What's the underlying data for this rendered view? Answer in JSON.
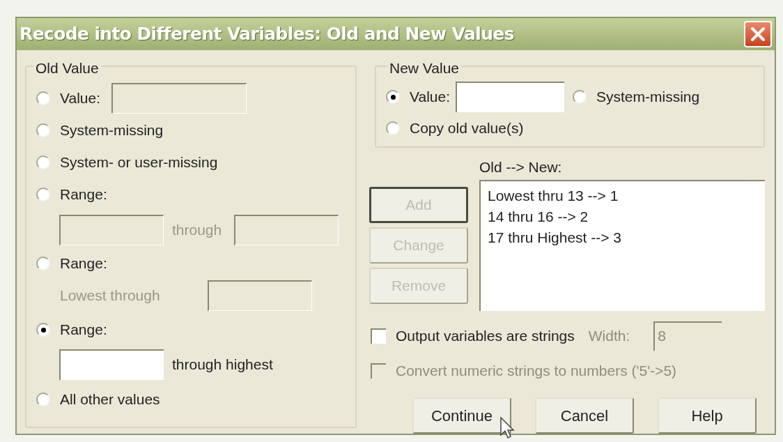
{
  "window": {
    "title": "Recode into Different Variables: Old and New Values"
  },
  "old_value": {
    "label": "Old Value",
    "options": [
      {
        "kind": "value",
        "label": "Value:",
        "selected": false
      },
      {
        "kind": "plain",
        "label": "System-missing",
        "selected": false
      },
      {
        "kind": "plain",
        "label": "System- or user-missing",
        "selected": false
      },
      {
        "kind": "range",
        "label": "Range:",
        "selected": false,
        "middle": "through"
      },
      {
        "kind": "lowest",
        "label": "Range:",
        "selected": false,
        "prefix": "Lowest through"
      },
      {
        "kind": "highest",
        "label": "Range:",
        "selected": true,
        "suffix": "through highest"
      },
      {
        "kind": "plain",
        "label": "All other values",
        "selected": false
      }
    ]
  },
  "new_value": {
    "label": "New Value",
    "options": [
      {
        "kind": "value",
        "label": "Value:",
        "selected": true
      },
      {
        "kind": "plain",
        "label": "System-missing",
        "selected": false
      },
      {
        "kind": "plain",
        "label": "Copy old value(s)",
        "selected": false
      }
    ]
  },
  "mappings": {
    "label": "Old --> New:",
    "items": [
      "Lowest thru 13 --> 1",
      "14 thru 16 --> 2",
      "17 thru Highest --> 3"
    ]
  },
  "list_buttons": [
    {
      "label": "Add",
      "disabled": true,
      "default": true
    },
    {
      "label": "Change",
      "disabled": true,
      "default": false
    },
    {
      "label": "Remove",
      "disabled": true,
      "default": false
    }
  ],
  "checkboxes": [
    {
      "label": "Output variables are strings",
      "checked": false,
      "disabled": false
    },
    {
      "label": "Convert numeric strings to numbers ('5'->5)",
      "checked": false,
      "disabled": true
    }
  ],
  "width": {
    "label": "Width:",
    "value": "8",
    "disabled": true
  },
  "buttons": [
    {
      "label": "Continue"
    },
    {
      "label": "Cancel"
    },
    {
      "label": "Help"
    }
  ]
}
